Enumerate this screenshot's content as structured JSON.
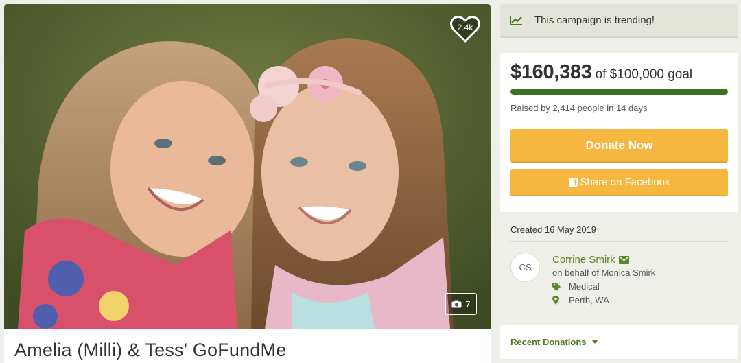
{
  "campaign": {
    "title": "Amelia (Milli) & Tess' GoFundMe",
    "hearts": "2.4k",
    "photo_count": "7"
  },
  "trending": {
    "text": "This campaign is trending!",
    "icon": "trend-chart-icon"
  },
  "funding": {
    "raised": "$160,383",
    "goal_text": "of $100,000 goal",
    "progress_fraction": 1.0,
    "raised_by": "Raised by 2,414 people in 14 days"
  },
  "actions": {
    "donate_label": "Donate Now",
    "share_label": "Share on Facebook"
  },
  "created": "Created 16 May 2019",
  "organizer": {
    "initials": "CS",
    "name": "Corrine Smirk",
    "on_behalf": "on behalf of Monica Smirk",
    "category": "Medical",
    "location": "Perth, WA"
  },
  "recent_donations_label": "Recent Donations",
  "colors": {
    "accent_green": "#5a8a24",
    "progress_green": "#3a7222",
    "button_orange": "#f5b73f",
    "trending_bg": "#e4e5da",
    "page_bg": "#efefea"
  }
}
